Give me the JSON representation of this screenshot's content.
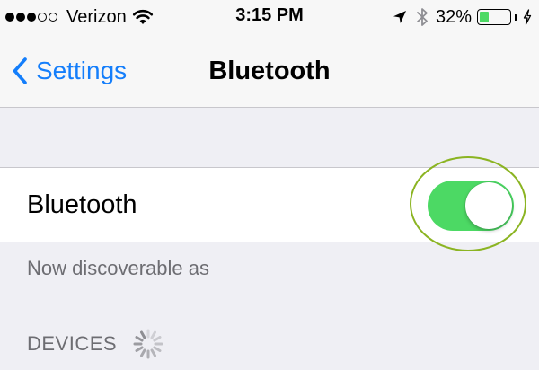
{
  "status_bar": {
    "carrier": "Verizon",
    "signal_strength": 3,
    "signal_max": 5,
    "time": "3:15 PM",
    "battery_percent_label": "32%",
    "battery_level": 0.32,
    "battery_color": "#4cd964",
    "icons": [
      "wifi-icon",
      "location-arrow-icon",
      "bluetooth-icon",
      "battery-icon",
      "charging-bolt-icon"
    ]
  },
  "nav": {
    "back_label": "Settings",
    "title": "Bluetooth",
    "accent_color": "#147efb"
  },
  "bluetooth_row": {
    "label": "Bluetooth",
    "enabled": true,
    "toggle_color": "#4cd964"
  },
  "footer_note": "Now discoverable as",
  "devices_section": {
    "header": "DEVICES",
    "loading": true
  }
}
